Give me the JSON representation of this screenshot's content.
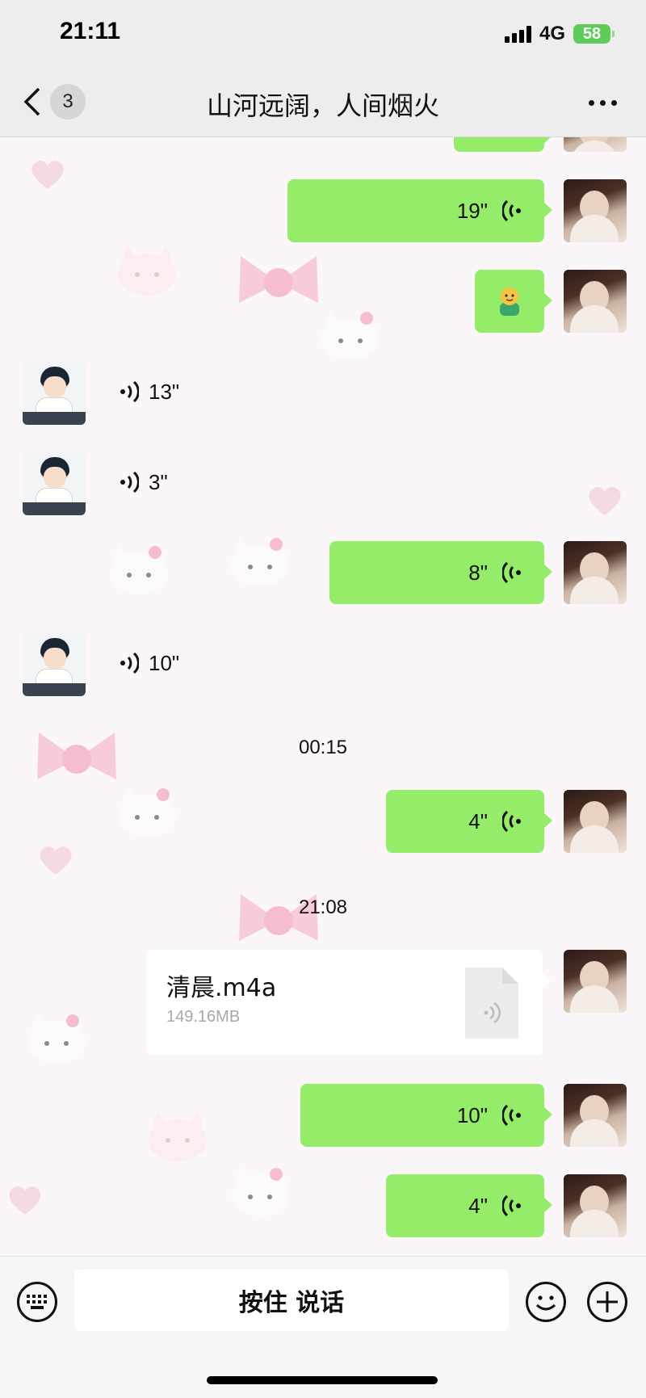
{
  "status_bar": {
    "time": "21:11",
    "network": "4G",
    "battery": "58"
  },
  "nav": {
    "unread_count": "3",
    "title": "山河远阔，人间烟火"
  },
  "messages": {
    "m1": {
      "duration": "19\""
    },
    "m3": {
      "duration": "13\""
    },
    "m4": {
      "duration": "3\""
    },
    "m5": {
      "duration": "8\""
    },
    "m6": {
      "duration": "10\""
    },
    "ts1": "00:15",
    "m7": {
      "duration": "4\""
    },
    "ts2": "21:08",
    "file": {
      "name": "清晨.m4a",
      "size": "149.16MB"
    },
    "m9": {
      "duration": "10\""
    },
    "m10": {
      "duration": "4\""
    }
  },
  "input_bar": {
    "hold_to_talk": "按住 说话"
  },
  "colors": {
    "bubble_green": "#95ec69",
    "wallpaper_pink": "#f7c8d6"
  }
}
